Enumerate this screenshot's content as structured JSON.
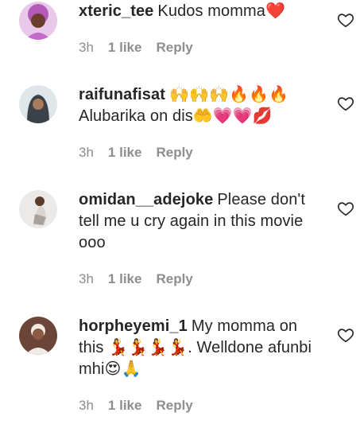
{
  "comments": [
    {
      "username": "xteric_tee",
      "text": "Kudos momma❤️",
      "time": "3h",
      "likes": "1 like",
      "reply": "Reply",
      "avatar_color": "#d6a3d9"
    },
    {
      "username": "raifunafisat",
      "text": "🙌🙌🙌🔥🔥🔥 Alubarika on dis🤲💗💗💋",
      "time": "3h",
      "likes": "1 like",
      "reply": "Reply",
      "avatar_color": "#9fb0bc"
    },
    {
      "username": "omidan__adejoke",
      "text": "Please don't tell me u cry again in this movie ooo",
      "time": "3h",
      "likes": "1 like",
      "reply": "Reply",
      "avatar_color": "#c9c2bd"
    },
    {
      "username": "horpheyemi_1",
      "text": "My momma on this 💃💃💃💃. Welldone afunbi mhi😍🙏",
      "time": "3h",
      "likes": "1 like",
      "reply": "Reply",
      "avatar_color": "#7a5a4a"
    }
  ]
}
